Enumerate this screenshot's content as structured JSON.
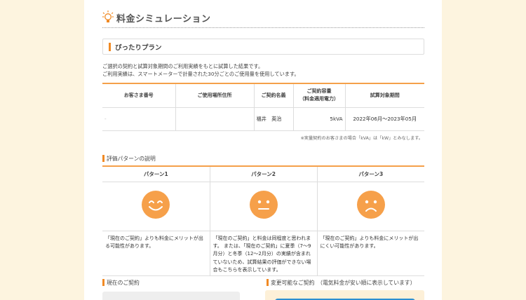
{
  "header": {
    "title": "料金シミュレーション",
    "icon": "lightbulb-icon",
    "accent_color": "#f08a24"
  },
  "plan": {
    "label": "ぴったりプラン"
  },
  "description": [
    "ご選択の契約と試算対象期間のご利用実績をもとに試算した結果です。",
    "ご利用実績は、スマートメーターで計量された30分ごとのご使用量を使用しています。"
  ],
  "contract_table": {
    "headers": [
      "お客さま番号",
      "ご使用場所住所",
      "ご契約名義",
      "ご契約容量\n（料金適用電力）",
      "試算対象期間"
    ],
    "row": {
      "customer_number": "-",
      "address": "",
      "name": "福井　英治",
      "capacity": "5kVA",
      "period": "2022年06月～2023年05月"
    },
    "note": "※実量契約のお客さまの場合「kVA」は「kW」とみなします。"
  },
  "patterns": {
    "heading": "評価パターンの説明",
    "items": [
      {
        "name": "パターン1",
        "face": "happy-face-icon",
        "text": "「現在のご契約」よりも料金にメリットが出る可能性があります。"
      },
      {
        "name": "パターン2",
        "face": "neutral-face-icon",
        "text": "「現在のご契約」と料金は同程度と思われます。 または、「現在のご契約」に夏季（7～9月分）と冬季（12～2月分）の実績が含まれていないため、試算結果の評価ができない場合もこちらを表示しています。"
      },
      {
        "name": "パターン3",
        "face": "sad-face-icon",
        "text": "「現在のご契約」よりも料金にメリットが出にくい可能性があります。"
      }
    ]
  },
  "sections": {
    "current": "現在のご契約",
    "changeable": "変更可能なご契約　（電気料金が安い順に表示しています）"
  }
}
